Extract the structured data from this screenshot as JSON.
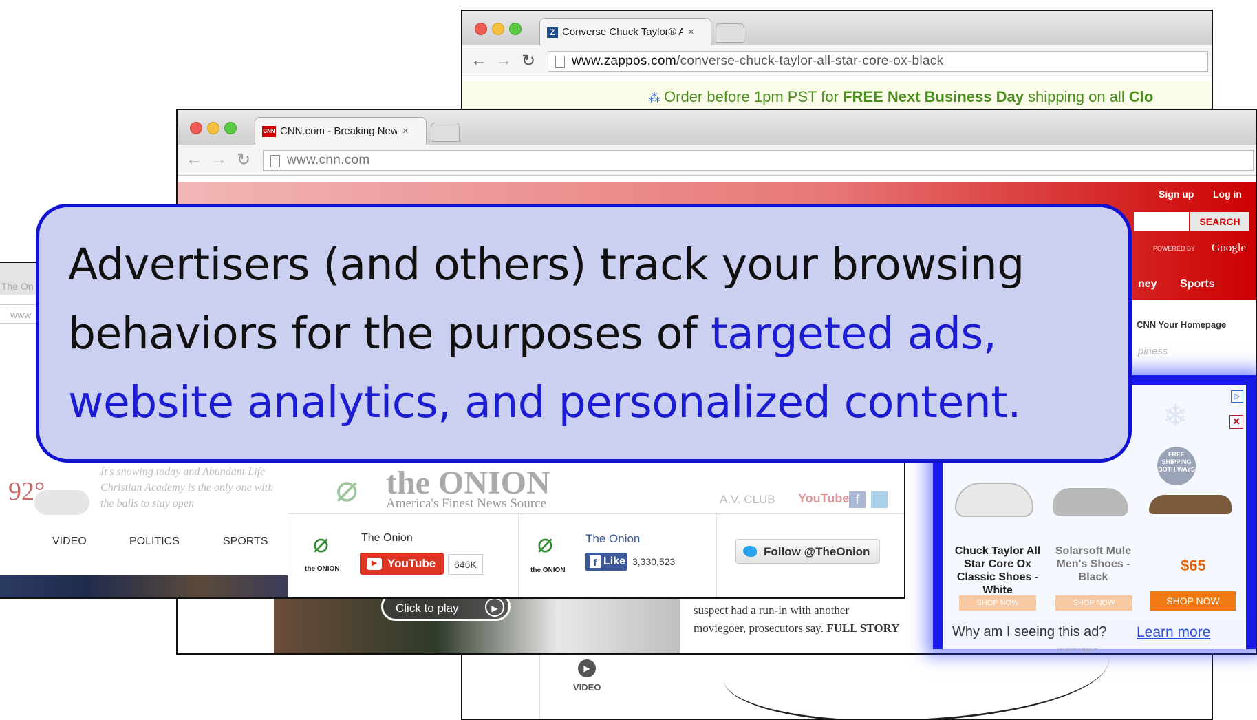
{
  "zappos_window": {
    "tab_title": "Converse Chuck Taylor® A",
    "tab_close": "×",
    "url_domain": "www.zappos.com",
    "url_path": "/converse-chuck-taylor-all-star-core-ox-black",
    "banner_prefix": "Order before 1pm PST for ",
    "banner_bold": "FREE Next Business Day",
    "banner_suffix": " shipping on all ",
    "banner_tail": "Clo",
    "video_label": "VIDEO"
  },
  "cnn_window": {
    "tab_title": "CNN.com - Breaking News",
    "tab_close": "×",
    "favicon_text": "CNN",
    "url": "www.cnn.com",
    "sign_up": "Sign up",
    "log_in": "Log in",
    "search_button": "SEARCH",
    "powered_by": "POWERED BY",
    "google": "Google",
    "nav_money_fragment": "ney",
    "nav_sports": "Sports",
    "your_homepage": "CNN Your Homepage",
    "happiness_fragment": "piness",
    "click_to_play": "Click to play",
    "story_text": "suspect had a run-in with another moviegoer, prosecutors say.",
    "story_link": "FULL STORY"
  },
  "onion_window": {
    "tab_fragment": "The On",
    "url_fragment": "www",
    "temperature": "92°",
    "weather_blurb": "It's snowing today and Abundant Life Christian Academy is the only one with the balls to stay open",
    "logo_text": "the ONION",
    "tagline": "America's Finest News Source",
    "av_club": "A.V. CLUB",
    "youtube_mini": "YouTube",
    "nav": [
      "VIDEO",
      "POLITICS",
      "SPORTS"
    ],
    "social": {
      "onion_small_label": "the ONION",
      "youtube_page_name": "The Onion",
      "youtube_button": "YouTube",
      "youtube_count": "646K",
      "fb_page_name": "The Onion",
      "fb_like": "Like",
      "fb_count": "3,330,523",
      "twitter_button": "Follow @TheOnion"
    }
  },
  "ad": {
    "badge": "FREE SHIPPING BOTH WAYS",
    "products": [
      {
        "name": "Chuck Taylor All Star Core Ox Classic Shoes - White",
        "price": "",
        "button": "SHOP NOW"
      },
      {
        "name": "Solarsoft Mule Men's Shoes - Black",
        "price": "",
        "button": "SHOP NOW"
      },
      {
        "name": "",
        "price": "$65",
        "button": "SHOP NOW"
      }
    ],
    "why_text": "Why am I seeing this ad?",
    "learn_more": "Learn more",
    "advertisement": "ADVERTISEMENT",
    "close": "×"
  },
  "callout": {
    "line1": "Advertisers (and others) track your browsing",
    "line2_black": "behaviors for the purposes of ",
    "line2_blue": "targeted ads,",
    "line3_blue": "website analytics, and personalized content."
  },
  "colors": {
    "callout_bg": "#cbcff0",
    "callout_border": "#1212d4",
    "highlight_blue": "#1c1cd0",
    "cnn_red": "#cc0000",
    "zappos_green": "#4b8f1e",
    "ad_glow": "#1a1ae8"
  }
}
